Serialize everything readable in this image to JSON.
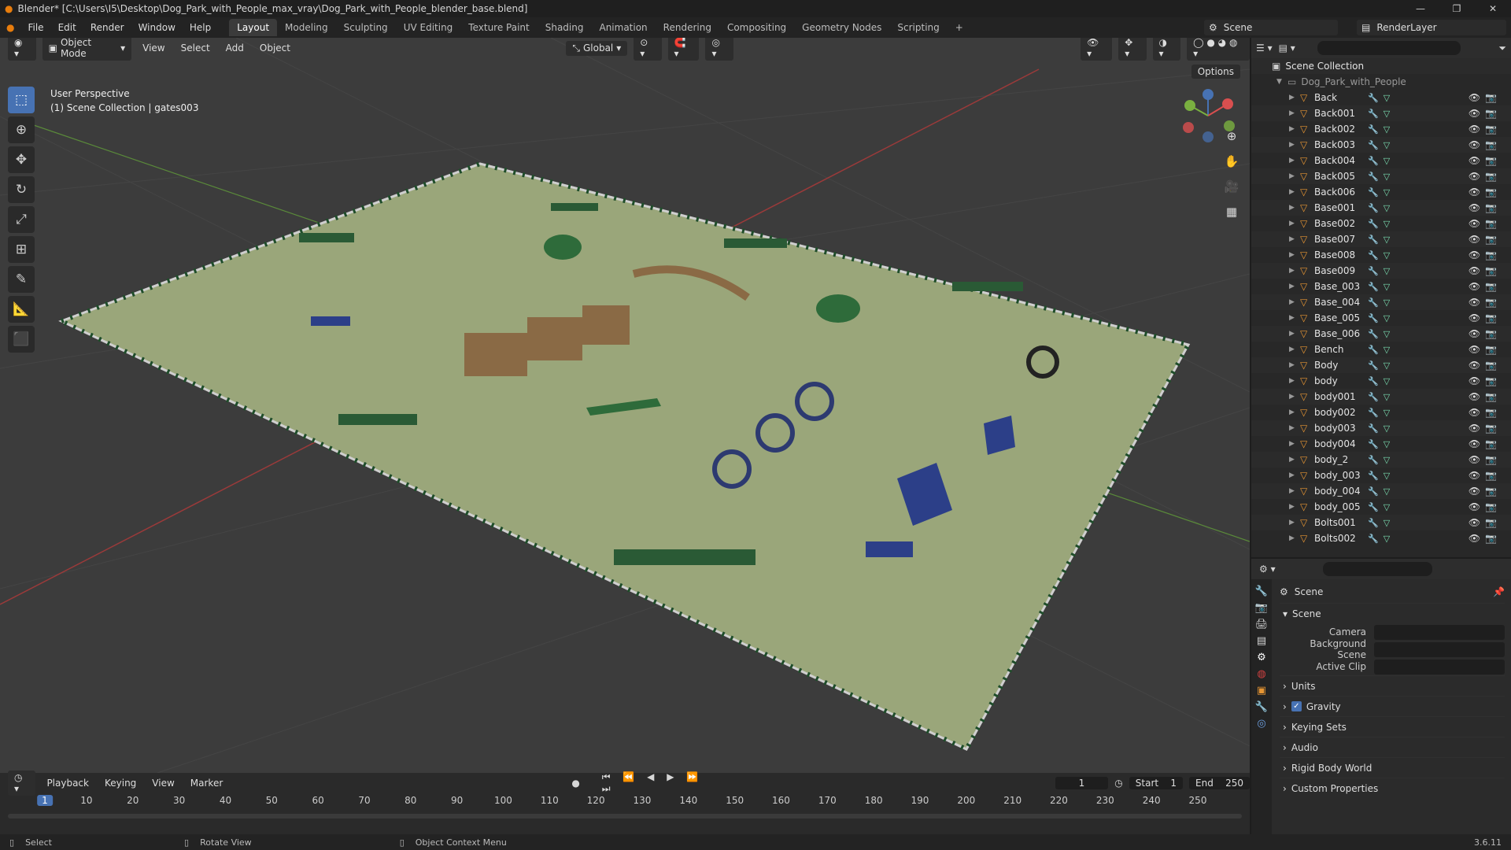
{
  "window": {
    "title": "Blender* [C:\\Users\\I5\\Desktop\\Dog_Park_with_People_max_vray\\Dog_Park_with_People_blender_base.blend]",
    "controls": [
      "—",
      "❐",
      "✕"
    ]
  },
  "menu": [
    "File",
    "Edit",
    "Render",
    "Window",
    "Help"
  ],
  "workspaces": [
    "Layout",
    "Modeling",
    "Sculpting",
    "UV Editing",
    "Texture Paint",
    "Shading",
    "Animation",
    "Rendering",
    "Compositing",
    "Geometry Nodes",
    "Scripting"
  ],
  "active_workspace": "Layout",
  "scene_name": "Scene",
  "render_layer": "RenderLayer",
  "viewport": {
    "mode": "Object Mode",
    "menus": [
      "View",
      "Select",
      "Add",
      "Object"
    ],
    "transform": "Global",
    "options": "Options",
    "info_line1": "User Perspective",
    "info_line2": "(1) Scene Collection | gates003"
  },
  "outliner": {
    "root": "Scene Collection",
    "collection": "Dog_Park_with_People",
    "items": [
      "Back",
      "Back001",
      "Back002",
      "Back003",
      "Back004",
      "Back005",
      "Back006",
      "Base001",
      "Base002",
      "Base007",
      "Base008",
      "Base009",
      "Base_003",
      "Base_004",
      "Base_005",
      "Base_006",
      "Bench",
      "Body",
      "body",
      "body001",
      "body002",
      "body003",
      "body004",
      "body_2",
      "body_003",
      "body_004",
      "body_005",
      "Bolts001",
      "Bolts002"
    ]
  },
  "properties": {
    "title": "Scene",
    "section": "Scene",
    "fields": [
      {
        "label": "Camera"
      },
      {
        "label": "Background Scene"
      },
      {
        "label": "Active Clip"
      }
    ],
    "panels": [
      "Units",
      "Gravity",
      "Keying Sets",
      "Audio",
      "Rigid Body World",
      "Custom Properties"
    ],
    "gravity_checked": true
  },
  "timeline": {
    "menus": [
      "Playback",
      "Keying",
      "View",
      "Marker"
    ],
    "current_frame": "1",
    "start_label": "Start",
    "start": "1",
    "end_label": "End",
    "end": "250",
    "ruler": [
      "1",
      "10",
      "20",
      "30",
      "40",
      "50",
      "60",
      "70",
      "80",
      "90",
      "100",
      "110",
      "120",
      "130",
      "140",
      "150",
      "160",
      "170",
      "180",
      "190",
      "200",
      "210",
      "220",
      "230",
      "240",
      "250"
    ]
  },
  "status": {
    "select": "Select",
    "rotate": "Rotate View",
    "context": "Object Context Menu",
    "version": "3.6.11"
  }
}
